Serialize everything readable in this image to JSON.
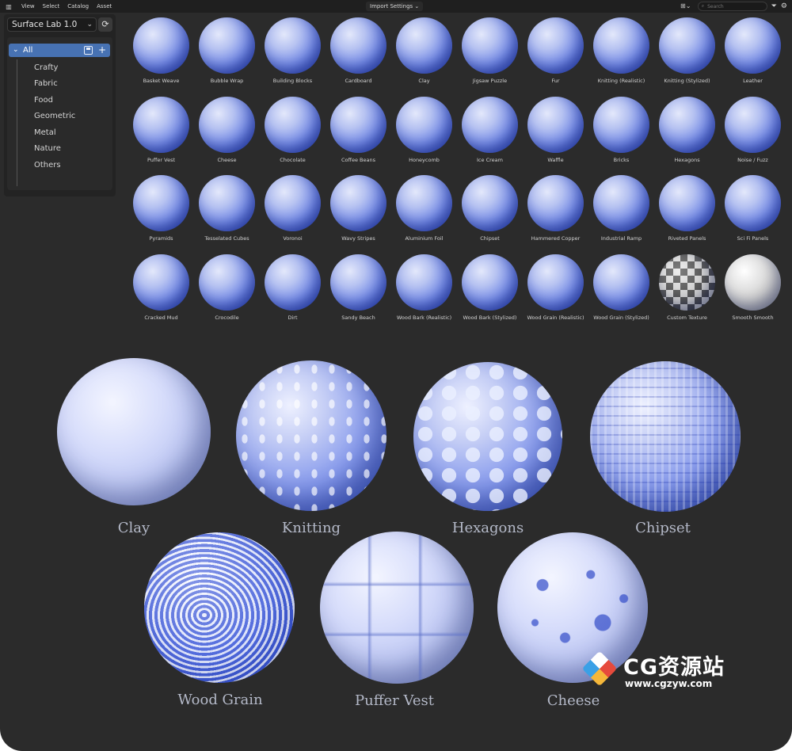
{
  "menubar": {
    "items": [
      "View",
      "Select",
      "Catalog",
      "Asset"
    ],
    "import_settings": "Import Settings",
    "search_placeholder": "Search"
  },
  "panel": {
    "library": "Surface Lab 1.0",
    "root": "All",
    "catalogs": [
      "Crafty",
      "Fabric",
      "Food",
      "Geometric",
      "Metal",
      "Nature",
      "Others"
    ]
  },
  "assets": [
    "Basket Weave",
    "Bubble Wrap",
    "Building Blocks",
    "Cardboard",
    "Clay",
    "Jigsaw Puzzle",
    "Fur",
    "Knitting (Realistic)",
    "Knitting (Stylized)",
    "Leather",
    "Puffer Vest",
    "Cheese",
    "Chocolate",
    "Coffee Beans",
    "Honeycomb",
    "Ice Cream",
    "Waffle",
    "Bricks",
    "Hexagons",
    "Noise / Fuzz",
    "Pyramids",
    "Tesselated Cubes",
    "Voronoi",
    "Wavy Stripes",
    "Aluminium Foil",
    "Chipset",
    "Hammered Copper",
    "Industrial Ramp",
    "Riveted Panels",
    "Sci Fi Panels",
    "Cracked Mud",
    "Crocodile",
    "Dirt",
    "Sandy Beach",
    "Wood Bark (Realistic)",
    "Wood Bark (Stylized)",
    "Wood Grain (Realistic)",
    "Wood Grain (Stylized)",
    "Custom Texture",
    "Smooth Smooth"
  ],
  "showcase": [
    "Clay",
    "Knitting",
    "Hexagons",
    "Chipset",
    "Wood Grain",
    "Puffer Vest",
    "Cheese"
  ],
  "watermark": {
    "title": "CG资源站",
    "url": "www.cgzyw.com"
  },
  "colors": {
    "accent": "#4772b3",
    "background": "#2b2b2b",
    "panel": "#232323",
    "material_blue": "#5570de"
  }
}
